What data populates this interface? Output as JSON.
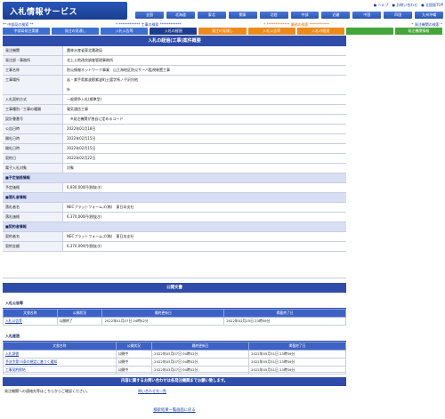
{
  "header": {
    "logo": "入札情報サービス",
    "util": [
      "● ヘルプ",
      "● お問い合わせ",
      "● 全国版TOP"
    ],
    "regions": [
      "全国",
      "北海道",
      "東北",
      "関東",
      "北陸",
      "中部",
      "近畿",
      "中国",
      "四国",
      "九州沖縄"
    ]
  },
  "bar2": {
    "items": [
      {
        "text": "** 中部局の検索 **",
        "cls": "sec"
      },
      {
        "text": "* ************ 工事の検索 ************",
        "cls": "sec"
      },
      {
        "text": "* ************* 業務の検索 ***********",
        "cls": "org"
      },
      {
        "text": "* 発注機関の検索 *",
        "cls": "sec"
      }
    ]
  },
  "tabs": [
    {
      "label": "中部局発注実績",
      "cls": "blue"
    },
    {
      "label": "発注の見通し",
      "cls": "blue"
    },
    {
      "label": "入札公告等",
      "cls": "blue"
    },
    {
      "label": "入札の経過",
      "cls": "active"
    },
    {
      "label": "発注の見通し",
      "cls": "orange"
    },
    {
      "label": "入札公告等",
      "cls": "orange"
    },
    {
      "label": "入札の経過",
      "cls": "orange"
    },
    {
      "label": "",
      "cls": "green"
    },
    {
      "label": "発注機関情報",
      "cls": "green"
    }
  ],
  "main": {
    "title": "入札の経過(工事)案件概要",
    "rows": [
      {
        "k": "発注機関",
        "v": "農林水産省東北農政局"
      },
      {
        "k": "発注部・事務所",
        "v": "北上土地改良調査管理事務所"
      },
      {
        "k": "工事名称",
        "v": "防災情報ネットワーク事業　山王海地区防災サーバ監視装置工事"
      },
      {
        "k": "工事場所",
        "v": "岩・紫手県紫波郡紫波町土舘字馬ノ子沢内他\n\n外"
      },
      {
        "k": "入札契約方式",
        "v": "一般競争入札(標準型)"
      },
      {
        "k": "工事種別／工事の種類",
        "v": "電気通信工事"
      },
      {
        "k": "設計書番号",
        "v": "　※発注機関が独自に定めるコード"
      },
      {
        "k": "公告日時",
        "v": "2022年01月18日"
      },
      {
        "k": "開札日時",
        "v": "2022年02月15日"
      },
      {
        "k": "開札日時",
        "v": "2022年02月15日"
      },
      {
        "k": "契約日",
        "v": "2022年02月22日"
      },
      {
        "k": "電子入札対象",
        "v": "対象"
      }
    ],
    "sub1": "■予定価格情報",
    "rows_a": [
      {
        "k": "予定価格",
        "v": "6,930,000円(税抜き)"
      }
    ],
    "sub2": "■落札者情報",
    "rows_b": [
      {
        "k": "落札者名",
        "v": "NECプラットフォームズ(株)　東日本支社"
      },
      {
        "k": "落札価格",
        "v": "6,370,000円(税抜き)"
      }
    ],
    "sub3": "■契約者情報",
    "rows_c": [
      {
        "k": "契約者名",
        "v": "NECプラットフォームズ(株)　東日本支社"
      },
      {
        "k": "契約金額",
        "v": "6,370,000円(税抜き)"
      }
    ]
  },
  "docs": {
    "title": "公開文書",
    "sec1": "入札公告等",
    "headers": [
      "文書名称",
      "公開状況",
      "最終更新日",
      "掲載終了日"
    ],
    "t1": [
      [
        "入札公告等",
        "公開終了",
        "2022年01月07日 04時02分",
        "2022年02月15日 23時59分"
      ]
    ],
    "sec2": "入札経過",
    "t2": [
      [
        "入札調書",
        "公開中",
        "2022年03月07日 04時02分",
        "2022年05月31日 23時59分"
      ],
      [
        "予決令第75条の規定に基づく通知",
        "公開中",
        "2022年03月07日 04時02分",
        "2022年05月31日 23時59分"
      ],
      [
        "工事契約締結",
        "公開中",
        "2022年03月07日 04時02分",
        "2022年05月31日 23時59分"
      ]
    ]
  },
  "contact": {
    "title": "内容に関するお問い合わせは各発注機関までお願い致します。",
    "text": "発注機関への連絡先等はこちらからご確認ください。",
    "link": "問い合わせ先一覧"
  },
  "footer": {
    "back": "検索結果一覧画面に戻る"
  }
}
